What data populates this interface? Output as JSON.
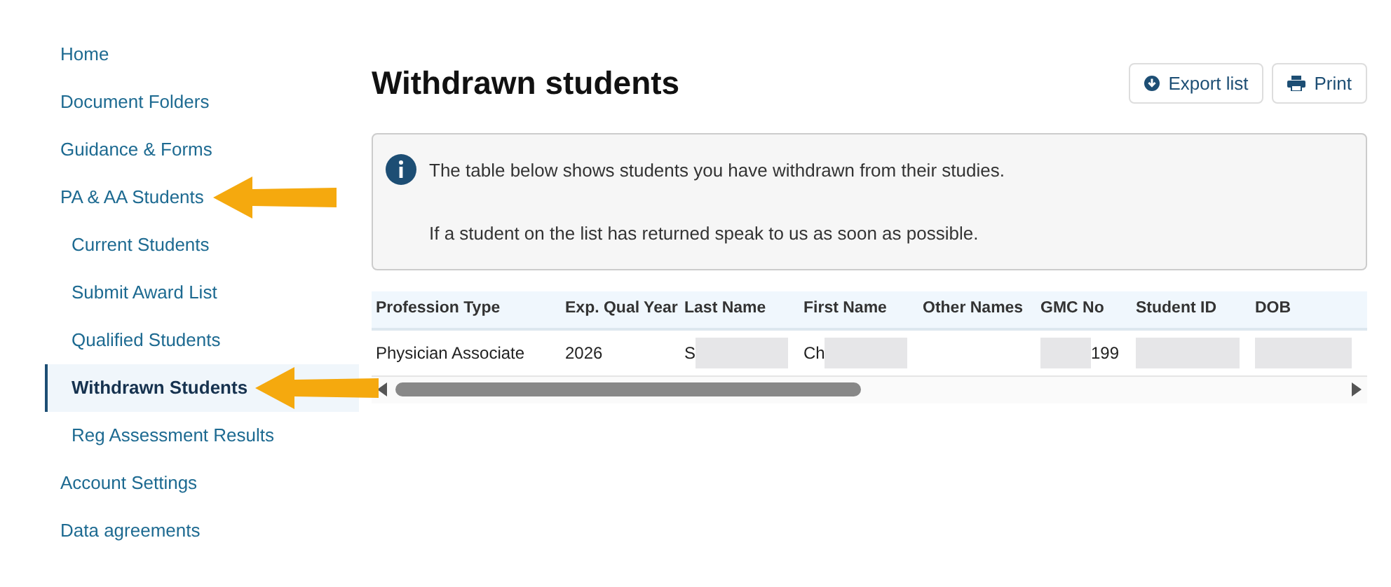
{
  "sidebar": {
    "items": [
      {
        "label": "Home",
        "selected": false
      },
      {
        "label": "Document Folders",
        "selected": false
      },
      {
        "label": "Guidance & Forms",
        "selected": false
      },
      {
        "label": "PA & AA Students",
        "selected": false,
        "annotated": true,
        "children": [
          {
            "label": "Current Students",
            "selected": false
          },
          {
            "label": "Submit Award List",
            "selected": false
          },
          {
            "label": "Qualified Students",
            "selected": false
          },
          {
            "label": "Withdrawn Students",
            "selected": true,
            "annotated": true
          },
          {
            "label": "Reg Assessment Results",
            "selected": false
          }
        ]
      },
      {
        "label": "Account Settings",
        "selected": false
      },
      {
        "label": "Data agreements",
        "selected": false
      }
    ]
  },
  "page": {
    "title": "Withdrawn students",
    "buttons": [
      {
        "label": "Export list",
        "kind": "export"
      },
      {
        "label": "Print",
        "kind": "print"
      }
    ]
  },
  "info": {
    "lines": [
      "The table below shows students you have withdrawn from their studies.",
      "If a student on the list has returned speak to us as soon as possible."
    ]
  },
  "table": {
    "columns": [
      "Profession Type",
      "Exp. Qual Year",
      "Last Name",
      "First Name",
      "Other Names",
      "GMC No",
      "Student ID",
      "DOB"
    ],
    "rows": [
      [
        {
          "text": "Physician Associate",
          "kind": "plain"
        },
        {
          "text": "2026",
          "kind": "plain"
        },
        {
          "text": "S",
          "kind": "tail_redacted"
        },
        {
          "text": "Ch",
          "kind": "tail_redacted"
        },
        {
          "kind": "plain"
        },
        {
          "text": "199",
          "kind": "head_redacted"
        },
        {
          "kind": "redacted"
        },
        {
          "kind": "redacted"
        }
      ]
    ]
  }
}
